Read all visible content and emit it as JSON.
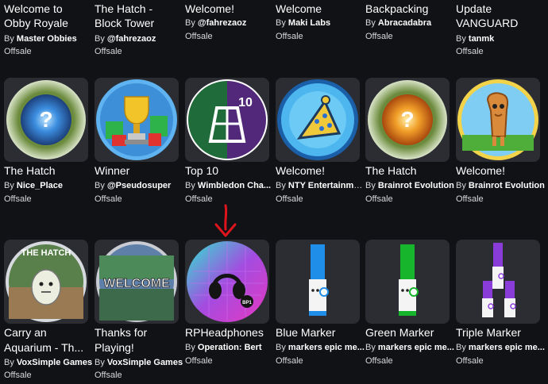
{
  "row1": [
    {
      "title": [
        "Welcome to",
        "Obby Royale"
      ],
      "by_label": "By",
      "creator": "Master Obbies",
      "status": "Offsale"
    },
    {
      "title": [
        "The Hatch -",
        "Block Tower"
      ],
      "by_label": "By",
      "creator": "@fahrezaoz",
      "status": "Offsale"
    },
    {
      "title": [
        "Welcome!"
      ],
      "by_label": "By",
      "creator": "@fahrezaoz",
      "status": "Offsale"
    },
    {
      "title": [
        "Welcome"
      ],
      "by_label": "By",
      "creator": "Maki Labs",
      "status": "Offsale"
    },
    {
      "title": [
        "Backpacking"
      ],
      "by_label": "By",
      "creator": "Abracadabra",
      "status": "Offsale"
    },
    {
      "title": [
        "Update",
        "VANGUARD"
      ],
      "by_label": "By",
      "creator": "tanmk",
      "status": "Offsale"
    }
  ],
  "row2": [
    {
      "title": [
        "The Hatch"
      ],
      "by_label": "By",
      "creator": "Nice_Place",
      "status": "Offsale",
      "icon": "blue-question-orb-badge-icon"
    },
    {
      "title": [
        "Winner"
      ],
      "by_label": "By",
      "creator": "@Pseudosuper",
      "status": "Offsale",
      "icon": "trophy-badge-icon"
    },
    {
      "title": [
        "Top 10"
      ],
      "by_label": "By",
      "creator": "Wimbledon Cha...",
      "status": "Offsale",
      "icon": "tennis-court-top10-badge-icon",
      "badge_number": "10"
    },
    {
      "title": [
        "Welcome!"
      ],
      "by_label": "By",
      "creator": "NTY Entertainme...",
      "status": "Offsale",
      "icon": "party-hat-badge-icon"
    },
    {
      "title": [
        "The Hatch"
      ],
      "by_label": "By",
      "creator": "Brainrot Evolution",
      "status": "Offsale",
      "icon": "orange-question-orb-badge-icon"
    },
    {
      "title": [
        "Welcome!"
      ],
      "by_label": "By",
      "creator": "Brainrot Evolution",
      "status": "Offsale",
      "icon": "wooden-character-badge-icon"
    }
  ],
  "row3": [
    {
      "title": [
        "Carry an",
        "Aquarium - Th..."
      ],
      "by_label": "By",
      "creator": "VoxSimple Games",
      "status": "Offsale",
      "icon": "egg-hatch-badge-icon",
      "badge_text": "THE HATCH"
    },
    {
      "title": [
        "Thanks for",
        "Playing!"
      ],
      "by_label": "By",
      "creator": "VoxSimple Games",
      "status": "Offsale",
      "icon": "welcome-badge-icon",
      "badge_text": "WELCOME"
    },
    {
      "title": [
        "RPHeadphones"
      ],
      "by_label": "By",
      "creator": "Operation: Bert",
      "status": "Offsale",
      "icon": "headphones-badge-icon",
      "badge_text": "BP1"
    },
    {
      "title": [
        "Blue Marker"
      ],
      "by_label": "By",
      "creator": "markers epic me...",
      "status": "Offsale",
      "icon": "blue-marker-icon"
    },
    {
      "title": [
        "Green Marker"
      ],
      "by_label": "By",
      "creator": "markers epic me...",
      "status": "Offsale",
      "icon": "green-marker-icon"
    },
    {
      "title": [
        "Triple Marker"
      ],
      "by_label": "By",
      "creator": "markers epic me...",
      "status": "Offsale",
      "icon": "triple-marker-icon"
    }
  ],
  "colors": {
    "background": "#111216",
    "card": "#2b2d33",
    "arrow": "#e0141c",
    "blue_marker": "#1e8ee8",
    "green_marker": "#17b52c",
    "purple_marker": "#8a3cd8"
  }
}
